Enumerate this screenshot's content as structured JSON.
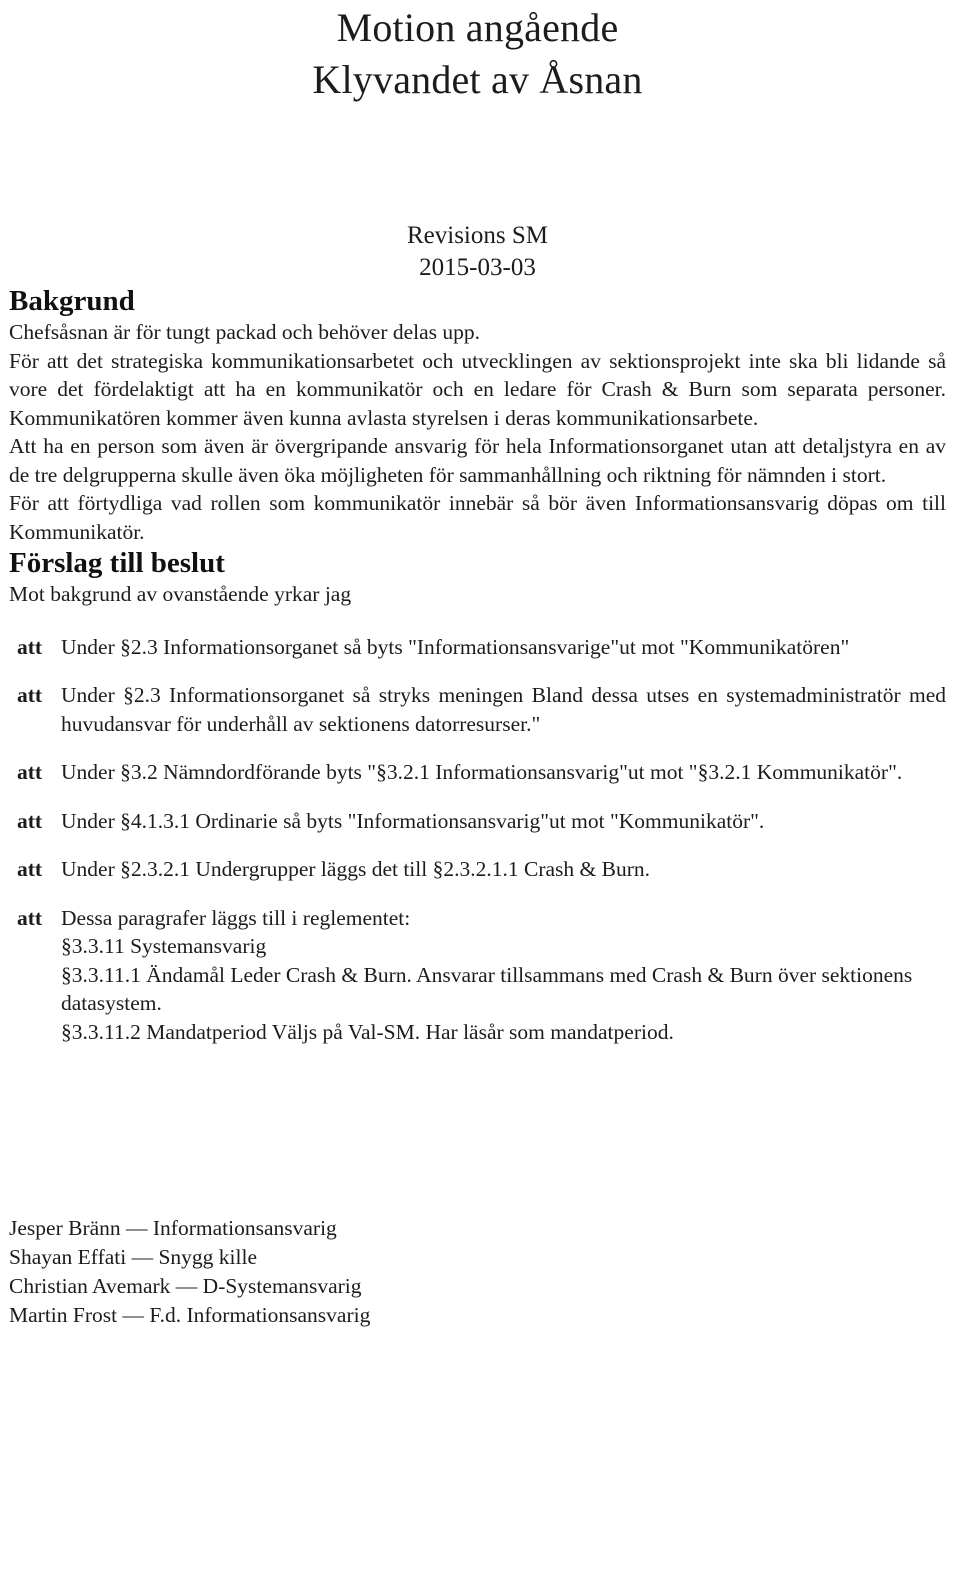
{
  "document": {
    "title_lines": [
      "Motion angående",
      "Klyvandet av Åsnan"
    ],
    "subtitle_lines": [
      "Revisions SM",
      "2015-03-03"
    ]
  },
  "bakgrund": {
    "heading": "Bakgrund",
    "paragraphs": [
      "Chefsåsnan är för tungt packad och behöver delas upp.",
      "För att det strategiska kommunikationsarbetet och utvecklingen av sektionsprojekt inte ska bli lidande så vore det fördelaktigt att ha en kommunikatör och en ledare för Crash & Burn som separata personer. Kommunikatören kommer även kunna avlasta styrelsen i deras kommunikationsarbete.",
      "Att ha en person som även är övergripande ansvarig för hela Informationsorganet utan att detaljstyra en av de tre delgrupperna skulle även öka möjligheten för sammanhållning och riktning för nämnden i stort.",
      "För att förtydliga vad rollen som kommunikatör innebär så bör även Informationsansvarig döpas om till Kommunikatör."
    ]
  },
  "forslag": {
    "heading": "Förslag till beslut",
    "intro": "Mot bakgrund av ovanstående yrkar jag",
    "marker": "att",
    "items": [
      {
        "text": "Under §2.3 Informationsorganet så byts \"Informationsansvarige\"ut mot \"Kommunikatören\"",
        "sublines": []
      },
      {
        "text": "Under §2.3 Informationsorganet så stryks meningen Bland dessa utses en systemadministratör med huvudansvar för underhåll av sektionens datorresurser.\"",
        "sublines": []
      },
      {
        "text": "Under §3.2 Nämndordförande byts \"§3.2.1 Informationsansvarig\"ut mot \"§3.2.1 Kommunikatör\".",
        "sublines": []
      },
      {
        "text": "Under §4.1.3.1 Ordinarie så byts \"Informationsansvarig\"ut mot \"Kommunikatör\".",
        "sublines": []
      },
      {
        "text": "Under §2.3.2.1 Undergrupper läggs det till §2.3.2.1.1 Crash & Burn.",
        "sublines": []
      },
      {
        "text": "Dessa paragrafer läggs till i reglementet:",
        "sublines": [
          "§3.3.11 Systemansvarig",
          "§3.3.11.1 Ändamål Leder Crash & Burn. Ansvarar tillsammans med Crash & Burn över sektionens datasystem.",
          "§3.3.11.2 Mandatperiod Väljs på Val-SM. Har läsår som mandatperiod."
        ]
      }
    ]
  },
  "signatures": [
    "Jesper Bränn — Informationsansvarig",
    "Shayan Effati — Snygg kille",
    "Christian Avemark — D-Systemansvarig",
    "Martin Frost — F.d. Informationsansvarig"
  ]
}
